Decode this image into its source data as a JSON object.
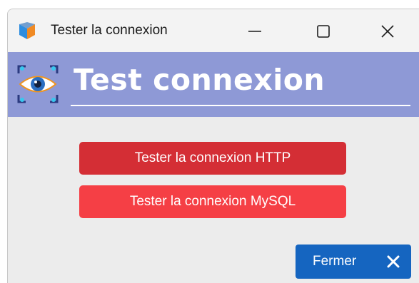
{
  "window": {
    "title": "Tester la connexion",
    "controls": [
      "minimize-icon",
      "maximize-icon",
      "close-icon"
    ]
  },
  "header": {
    "title": "Test connexion",
    "icon": "eye-icon",
    "background": "#8e99d6"
  },
  "actions": {
    "http_label": "Tester la connexion HTTP",
    "mysql_label": "Tester la connexion MySQL",
    "http_color": "#d42e35",
    "mysql_color": "#f53f45"
  },
  "footer": {
    "close_label": "Fermer",
    "close_icon": "x-icon",
    "close_color": "#1565c0"
  }
}
